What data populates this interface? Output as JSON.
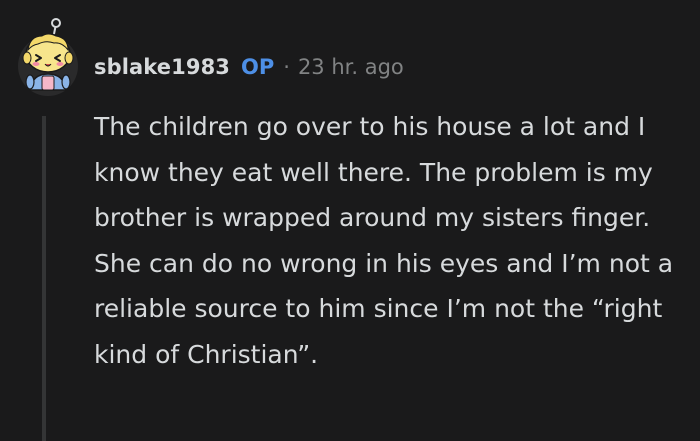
{
  "comment": {
    "author": "sblake1983",
    "badge": "OP",
    "separator": "·",
    "time": "23 hr. ago",
    "body": "The children go over to his house a lot and I know they eat well there. The problem is my brother is wrapped around my sisters finger. She can do no wrong in his eyes and I’m not a reliable source to him since I’m not the “right kind of Christian”."
  },
  "avatar": {
    "icon": "snoo-avatar-icon",
    "colors": {
      "skin": "#f7e58c",
      "blush": "#f28aa3",
      "sweater": "#8ab4e8",
      "shirt": "#f5b7c8",
      "outline": "#1a1a1b"
    }
  },
  "colors": {
    "background": "#1a1a1b",
    "text": "#d7dadc",
    "meta": "#818384",
    "op_badge": "#4d8fe6",
    "thread_line": "#343536"
  }
}
